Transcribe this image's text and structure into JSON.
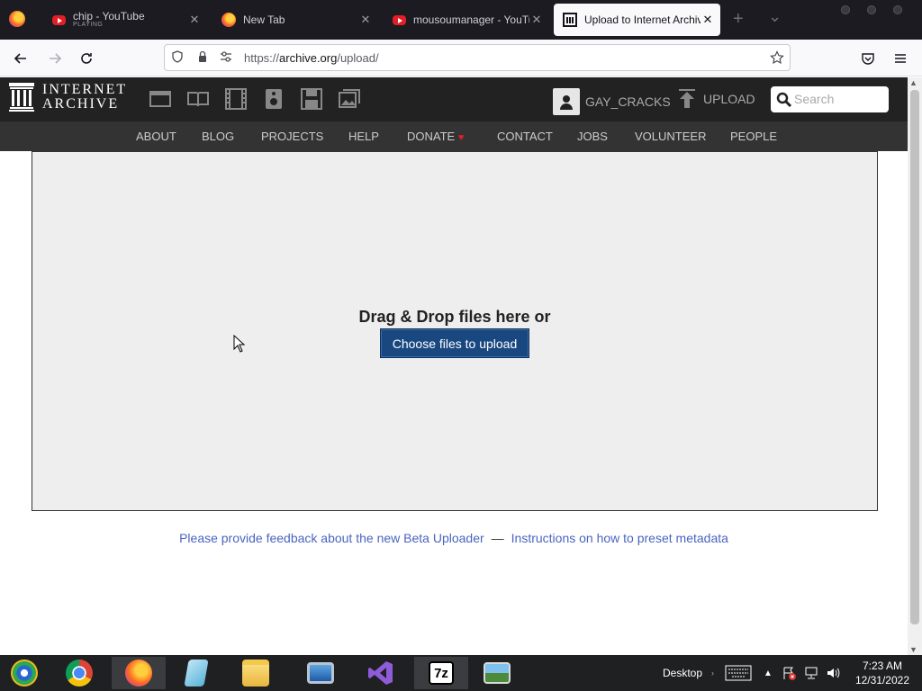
{
  "browser": {
    "tabs": [
      {
        "title": "chip - YouTube",
        "subtitle": "PLAYING",
        "icon": "youtube-icon",
        "active": false
      },
      {
        "title": "New Tab",
        "icon": "firefox-icon",
        "active": false
      },
      {
        "title": "mousoumanager - YouTube",
        "icon": "youtube-icon",
        "active": false
      },
      {
        "title": "Upload to Internet Archive",
        "icon": "internet-archive-icon",
        "active": true
      }
    ],
    "tab_close": "✕",
    "new_tab": "+",
    "list_tabs": "⌄",
    "url": {
      "prefix": "https://",
      "domain": "archive.org",
      "path": "/upload/"
    }
  },
  "ia_header": {
    "logo_line1": "INTERNET",
    "logo_line2": "ARCHIVE",
    "username": "GAY_CRACKS",
    "upload_label": "UPLOAD",
    "search_placeholder": "Search",
    "media_icons": [
      "web-icon",
      "texts-icon",
      "video-icon",
      "audio-icon",
      "software-icon",
      "images-icon"
    ]
  },
  "ia_nav": {
    "items": [
      "ABOUT",
      "BLOG",
      "PROJECTS",
      "HELP",
      "DONATE",
      "CONTACT",
      "JOBS",
      "VOLUNTEER",
      "PEOPLE"
    ],
    "donate_heart": "♥"
  },
  "upload": {
    "drop_text": "Drag & Drop files here or",
    "choose_button": "Choose files to upload",
    "feedback_link": "Please provide feedback about the new Beta Uploader",
    "separator": "—",
    "instructions_link": "Instructions on how to preset metadata"
  },
  "taskbar": {
    "apps": [
      "windows-start-icon",
      "chrome-icon",
      "firefox-icon",
      "notepad-icon",
      "file-explorer-icon",
      "remote-desktop-icon",
      "visual-studio-icon",
      "7zip-icon",
      "photo-viewer-icon"
    ],
    "desktop_label": "Desktop",
    "time": "7:23 AM",
    "date": "12/31/2022"
  },
  "colors": {
    "ia_header": "#222222",
    "ia_nav": "#333333",
    "button": "#194880",
    "link": "#4b64c0"
  }
}
